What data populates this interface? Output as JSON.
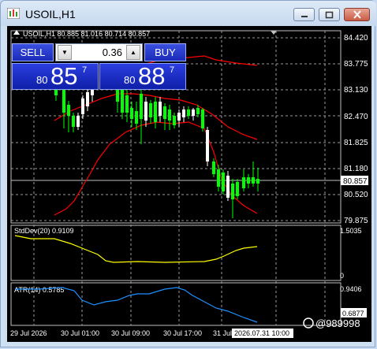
{
  "window": {
    "title": "USOIL,H1",
    "controls": [
      "minimize-icon",
      "restore-icon",
      "close-icon"
    ]
  },
  "chart": {
    "info_line": "USOIL,H1  80.885 81.016 80.714 80.857",
    "price_axis": [
      "84.420",
      "83.775",
      "83.130",
      "82.470",
      "81.825",
      "81.180",
      "80.520",
      "79.875"
    ],
    "current_price": "80.857",
    "stddev_label": "StdDev(20) 0.9109",
    "stddev_axis": [
      "1.5035",
      "0"
    ],
    "atr_label": "ATR(14) 0.5785",
    "atr_axis": [
      "0.9406",
      "0.6877"
    ],
    "time_axis": [
      "29 Jul 2026",
      "30 Jul 01:00",
      "30 Jul 09:00",
      "30 Jul 17:00",
      "31 Jul"
    ],
    "time_cursor": "2026.07.31 10:00",
    "watermark": "@989998"
  },
  "trade_panel": {
    "sell_label": "SELL",
    "buy_label": "BUY",
    "lot": "0.36",
    "sell_small": "80",
    "sell_big": "85",
    "sell_sup": "7",
    "buy_small": "80",
    "buy_big": "88",
    "buy_sup": "7"
  },
  "colors": {
    "background": "#000000",
    "grid": "#c0c0c0",
    "bull": "#ffffff",
    "bear": "#00ff00",
    "bands": "#ff0000",
    "stddev": "#ffff00",
    "atr": "#1e90ff",
    "panel": "#1a2bb8"
  }
}
